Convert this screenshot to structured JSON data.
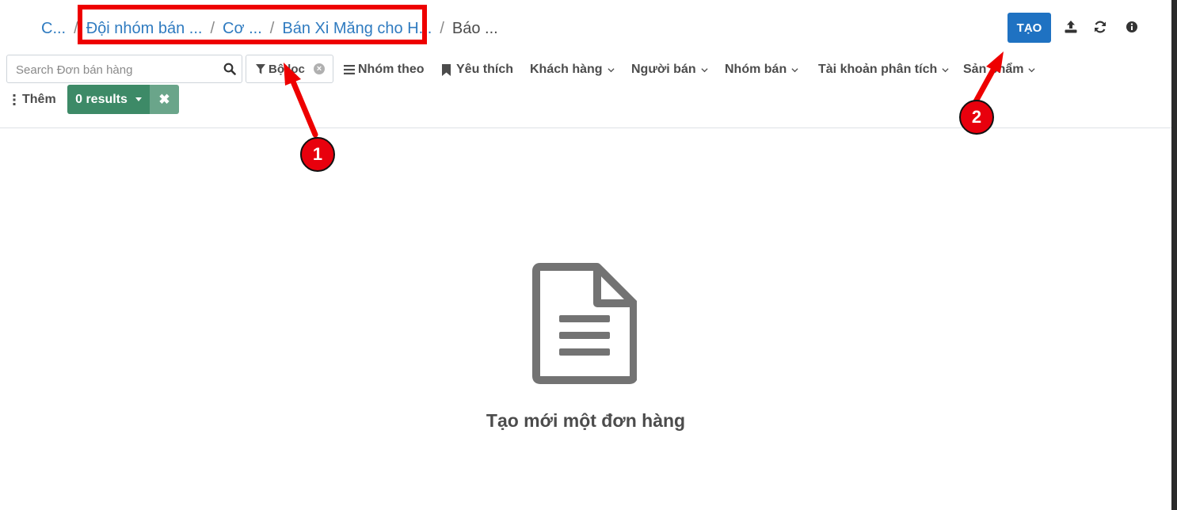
{
  "breadcrumb": {
    "items": [
      "C...",
      "Đội nhóm bán ...",
      "Cơ ...",
      "Bán Xi Măng cho H..."
    ],
    "active": "Báo ...",
    "separator": "/"
  },
  "actions": {
    "create_label": "TẠO",
    "upload_icon": "upload-icon",
    "refresh_icon": "refresh-icon",
    "info_icon": "info-icon"
  },
  "search": {
    "placeholder": "Search Đơn bán hàng",
    "value": ""
  },
  "filter_chip": {
    "label": "Bộ lọc"
  },
  "toolbar": {
    "group_by": "Nhóm theo",
    "favorites": "Yêu thích",
    "customer": "Khách hàng",
    "salesperson": "Người bán",
    "sales_team": "Nhóm bán",
    "analytic_account": "Tài khoản phân tích",
    "product": "Sản phẩm",
    "more": "Thêm",
    "results": "0 results"
  },
  "empty_state": {
    "icon": "document-icon",
    "message": "Tạo mới một đơn hàng"
  },
  "annotations": {
    "badge_1": "1",
    "badge_2": "2",
    "color": "#ee0000"
  },
  "colors": {
    "primary": "#1f72c2",
    "link": "#2f7bc0",
    "results_green": "#3d8a67"
  }
}
